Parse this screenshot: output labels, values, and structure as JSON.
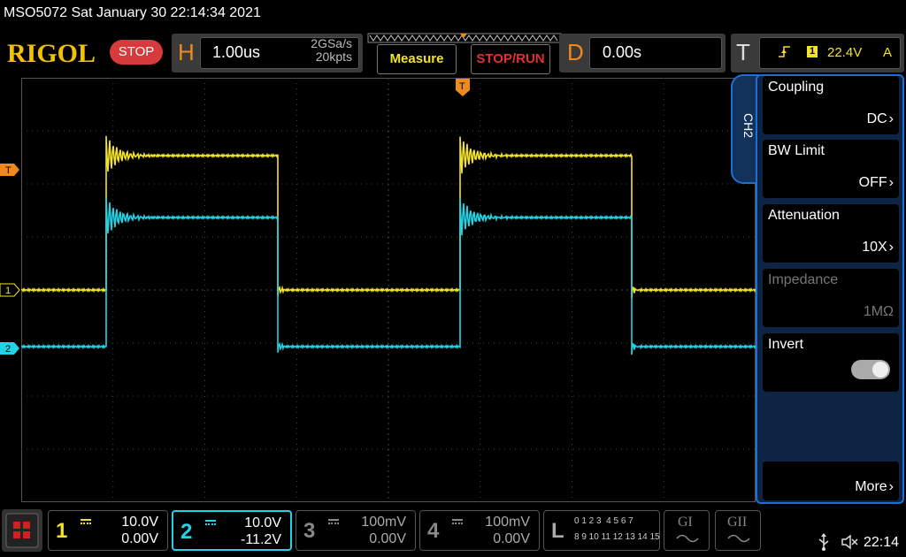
{
  "window_title": "MSO5072  Sat January 30 22:14:34 2021",
  "header": {
    "logo": "RIGOL",
    "run_state": "STOP",
    "horizontal": {
      "letter": "H",
      "timebase": "1.00us",
      "sample_rate": "2GSa/s",
      "mem_depth": "20kpts"
    },
    "measure_label": "Measure",
    "stop_run_label": "STOP/RUN",
    "delay": {
      "letter": "D",
      "value": "0.00s"
    },
    "trigger": {
      "letter": "T",
      "source": "1",
      "level": "22.4V",
      "mode": "A"
    }
  },
  "markers": {
    "trigger_pos": "T",
    "ch1": "1",
    "ch2": "2",
    "trig_level": "T"
  },
  "side_menu": {
    "tab": "CH2",
    "items": [
      {
        "title": "Coupling",
        "value": "DC"
      },
      {
        "title": "BW Limit",
        "value": "OFF"
      },
      {
        "title": "Attenuation",
        "value": "10X"
      },
      {
        "title": "Impedance",
        "value": "1MΩ"
      },
      {
        "title": "Invert",
        "value": ""
      },
      {
        "title": "",
        "value": "More"
      }
    ]
  },
  "channels": [
    {
      "num": "1",
      "scale": "10.0V",
      "offset": "0.00V",
      "color": "#f2e22a"
    },
    {
      "num": "2",
      "scale": "10.0V",
      "offset": "-11.2V",
      "color": "#22d3e6"
    },
    {
      "num": "3",
      "scale": "100mV",
      "offset": "0.00V",
      "color": "#888888"
    },
    {
      "num": "4",
      "scale": "100mV",
      "offset": "0.00V",
      "color": "#888888"
    }
  ],
  "logic": {
    "letter": "L",
    "row1": "0 1 2 3  4 5 6 7",
    "row2": "8 9 10 11 12 13 14 15"
  },
  "gen1": "GI",
  "gen2": "GII",
  "clock": "22:14",
  "colors": {
    "ch1": "#f2e22a",
    "ch2": "#22d3e6",
    "accent": "#f08a1c",
    "panel_border": "#1d6fd6"
  }
}
